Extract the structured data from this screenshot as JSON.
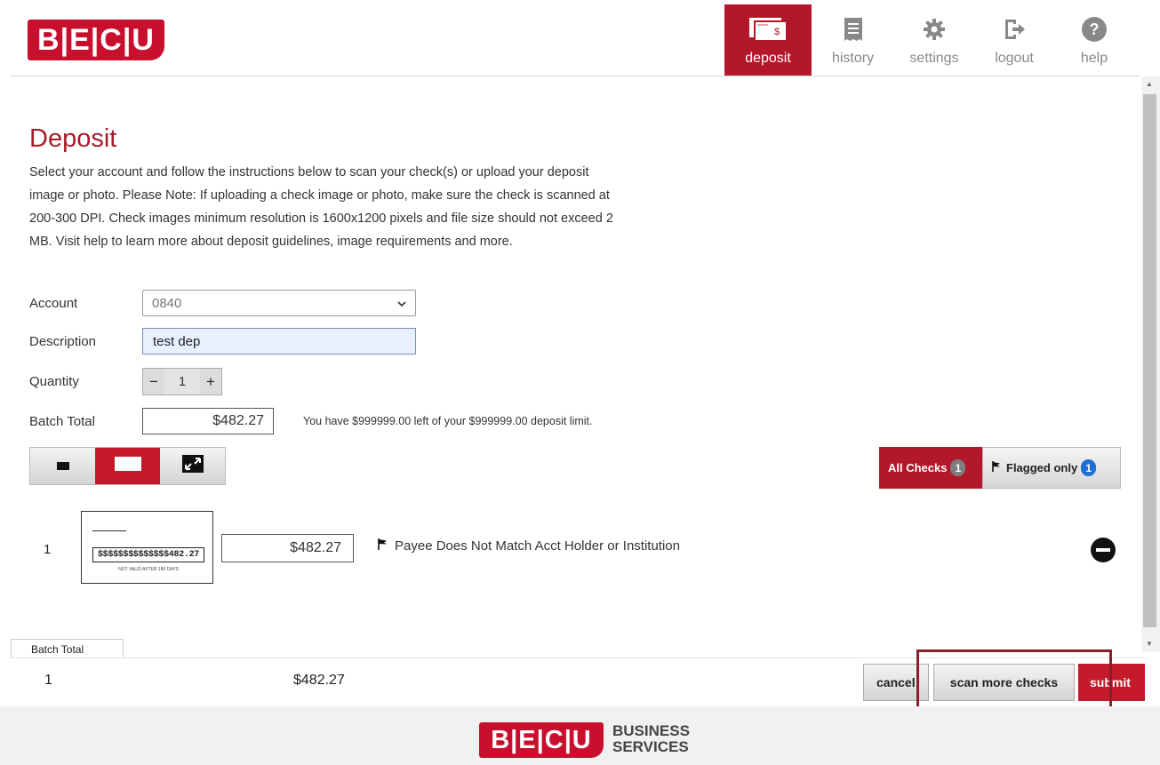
{
  "brand": {
    "logo_text": "B|E|C|U",
    "footer_sub_line1": "BUSINESS",
    "footer_sub_line2": "SERVICES",
    "color": "#c8102e"
  },
  "nav": [
    {
      "label": "deposit",
      "icon": "check-deposit-icon",
      "active": true
    },
    {
      "label": "history",
      "icon": "receipt-icon",
      "active": false
    },
    {
      "label": "settings",
      "icon": "gear-icon",
      "active": false
    },
    {
      "label": "logout",
      "icon": "logout-icon",
      "active": false
    },
    {
      "label": "help",
      "icon": "help-icon",
      "active": false
    }
  ],
  "page": {
    "title": "Deposit",
    "intro": "Select your account and follow the instructions below to scan your check(s) or upload your deposit image or photo. Please Note: If uploading a check image or photo, make sure the check is scanned at 200-300 DPI. Check images minimum resolution is 1600x1200 pixels and file size should not exceed 2 MB. Visit help to learn more about deposit guidelines, image requirements and more."
  },
  "form": {
    "account_label": "Account",
    "account_value": "0840",
    "description_label": "Description",
    "description_value": "test dep",
    "quantity_label": "Quantity",
    "quantity_minus": "−",
    "quantity_value": "1",
    "quantity_plus": "+",
    "batch_total_label": "Batch Total",
    "batch_total_value": "$482.27",
    "limit_text": "You have $999999.00 left of your $999999.00 deposit limit."
  },
  "filters": {
    "all_label": "All Checks",
    "all_count": "1",
    "flagged_label": "Flagged only",
    "flagged_count": "1"
  },
  "checks": [
    {
      "index": "1",
      "thumb_amount": "$$$$$$$$$$$$$$482.27",
      "thumb_note": "NOT VALID AFTER 180 DAYS",
      "amount": "$482.27",
      "flag_message": "Payee Does Not Match Acct Holder or Institution"
    }
  ],
  "bottom": {
    "tab_label": "Batch Total",
    "count": "1",
    "total": "$482.27",
    "cancel_label": "cancel",
    "scan_more_label": "scan more checks",
    "submit_label": "submit"
  }
}
